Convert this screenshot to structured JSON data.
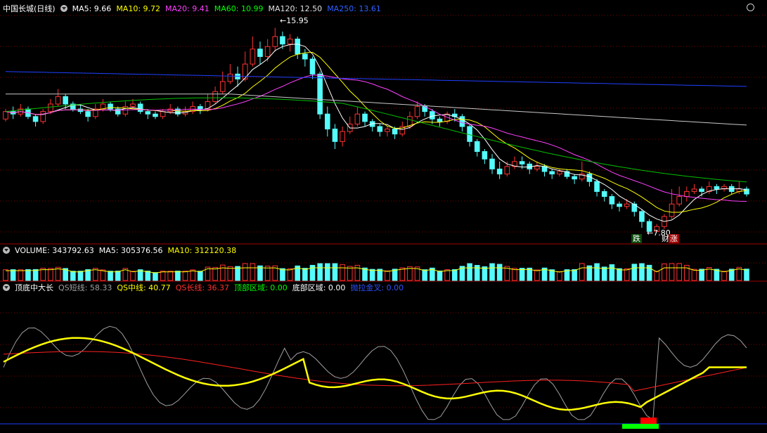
{
  "main_header": {
    "title": "中国长城(日线)",
    "ma_labels": [
      {
        "text": "MA5: 9.66",
        "color": "#ffffff"
      },
      {
        "text": "MA10: 9.72",
        "color": "#ffff00"
      },
      {
        "text": "MA20: 9.41",
        "color": "#ff40ff"
      },
      {
        "text": "MA60: 10.99",
        "color": "#00ff00"
      },
      {
        "text": "MA120: 12.50",
        "color": "#e0e0e0"
      },
      {
        "text": "MA250: 13.61",
        "color": "#3060ff"
      }
    ]
  },
  "volume_header": {
    "labels": [
      {
        "text": "VOLUME: 343792.63",
        "color": "#ffffff"
      },
      {
        "text": "MA5: 305376.56",
        "color": "#ffffff"
      },
      {
        "text": "MA10: 312120.38",
        "color": "#ffff00"
      }
    ]
  },
  "indicator_header": {
    "labels": [
      {
        "text": "顶底中大长",
        "color": "#ffffff"
      },
      {
        "text": "QS短线: 58.33",
        "color": "#a0a0a0"
      },
      {
        "text": "QS中线: 40.77",
        "color": "#ffff00"
      },
      {
        "text": "QS长线: 36.37",
        "color": "#ff3030"
      },
      {
        "text": "顶部区域: 0.00",
        "color": "#00ff00"
      },
      {
        "text": "底部区域: 0.00",
        "color": "#ffffff"
      },
      {
        "text": "抛拉金叉: 0.00",
        "color": "#3050ff"
      }
    ]
  },
  "markers": {
    "high": "15.95",
    "low": "7.80",
    "tag_fall": "跌",
    "tag_rise_1": "财",
    "tag_rise_2": "涨"
  },
  "colors": {
    "up": "#ff3232",
    "down": "#54fcfc",
    "grid": "#7a0000",
    "ma5": "#ffffff",
    "ma10": "#ffff00",
    "ma20": "#ff40ff",
    "ma60": "#00c000",
    "ma120": "#c8c8c8",
    "ma250": "#2040ff"
  },
  "chart_data": {
    "type": "candlestick",
    "price_axis": {
      "high": 15.95,
      "low": 7.8
    },
    "ma_latest": {
      "MA5": 9.66,
      "MA10": 9.72,
      "MA20": 9.41,
      "MA60": 10.99,
      "MA120": 12.5,
      "MA250": 13.61
    },
    "candles": [
      [
        12.3,
        12.6,
        12.7,
        12.2
      ],
      [
        12.6,
        12.5,
        12.8,
        12.3
      ],
      [
        12.5,
        12.7,
        12.9,
        12.4
      ],
      [
        12.7,
        12.4,
        12.8,
        12.3
      ],
      [
        12.4,
        12.2,
        12.5,
        12.0
      ],
      [
        12.2,
        12.6,
        12.7,
        12.1
      ],
      [
        12.6,
        12.9,
        13.1,
        12.5
      ],
      [
        12.9,
        13.2,
        13.5,
        12.8
      ],
      [
        13.2,
        12.9,
        13.3,
        12.7
      ],
      [
        12.9,
        12.7,
        13.0,
        12.6
      ],
      [
        12.7,
        12.6,
        12.9,
        12.5
      ],
      [
        12.6,
        12.4,
        12.7,
        12.2
      ],
      [
        12.4,
        12.7,
        12.9,
        12.3
      ],
      [
        12.7,
        12.9,
        13.1,
        12.6
      ],
      [
        12.9,
        12.7,
        13.0,
        12.6
      ],
      [
        12.7,
        12.5,
        12.8,
        12.4
      ],
      [
        12.5,
        12.8,
        13.0,
        12.4
      ],
      [
        12.8,
        12.9,
        13.1,
        12.7
      ],
      [
        12.9,
        12.6,
        13.0,
        12.5
      ],
      [
        12.6,
        12.5,
        12.7,
        12.3
      ],
      [
        12.5,
        12.4,
        12.6,
        12.3
      ],
      [
        12.4,
        12.6,
        12.7,
        12.3
      ],
      [
        12.6,
        12.7,
        12.9,
        12.5
      ],
      [
        12.7,
        12.5,
        12.8,
        12.4
      ],
      [
        12.5,
        12.6,
        12.8,
        12.4
      ],
      [
        12.6,
        12.8,
        13.0,
        12.5
      ],
      [
        12.8,
        12.7,
        12.9,
        12.5
      ],
      [
        12.7,
        13.0,
        13.3,
        12.6
      ],
      [
        13.0,
        13.4,
        13.6,
        12.9
      ],
      [
        13.4,
        13.8,
        14.2,
        13.3
      ],
      [
        13.8,
        14.1,
        14.5,
        13.7
      ],
      [
        14.1,
        13.9,
        14.4,
        13.6
      ],
      [
        13.9,
        14.5,
        15.0,
        13.8
      ],
      [
        14.5,
        15.1,
        15.6,
        14.4
      ],
      [
        15.1,
        14.8,
        15.4,
        14.5
      ],
      [
        14.8,
        15.2,
        15.5,
        14.6
      ],
      [
        15.2,
        15.6,
        15.95,
        15.0
      ],
      [
        15.6,
        15.3,
        15.8,
        15.1
      ],
      [
        15.3,
        15.5,
        15.7,
        15.0
      ],
      [
        15.5,
        14.9,
        15.6,
        14.7
      ],
      [
        14.9,
        14.7,
        15.1,
        14.4
      ],
      [
        14.7,
        14.1,
        14.8,
        13.9
      ],
      [
        14.1,
        12.5,
        14.2,
        12.3
      ],
      [
        12.5,
        11.9,
        12.8,
        11.6
      ],
      [
        11.9,
        11.4,
        12.1,
        11.1
      ],
      [
        11.4,
        11.8,
        12.0,
        11.2
      ],
      [
        11.8,
        12.1,
        12.4,
        11.7
      ],
      [
        12.1,
        12.5,
        12.8,
        12.0
      ],
      [
        12.5,
        12.2,
        12.6,
        12.0
      ],
      [
        12.2,
        12.0,
        12.3,
        11.8
      ],
      [
        12.0,
        11.8,
        12.1,
        11.6
      ],
      [
        11.8,
        11.9,
        12.0,
        11.6
      ],
      [
        11.9,
        11.7,
        12.0,
        11.5
      ],
      [
        11.7,
        12.0,
        12.2,
        11.6
      ],
      [
        12.0,
        12.4,
        12.6,
        11.9
      ],
      [
        12.4,
        12.8,
        13.0,
        12.3
      ],
      [
        12.8,
        12.6,
        12.9,
        12.4
      ],
      [
        12.6,
        12.3,
        12.7,
        12.1
      ],
      [
        12.3,
        12.2,
        12.4,
        12.0
      ],
      [
        12.2,
        12.5,
        12.6,
        12.1
      ],
      [
        12.5,
        12.4,
        12.7,
        12.2
      ],
      [
        12.4,
        12.0,
        12.5,
        11.8
      ],
      [
        12.0,
        11.4,
        12.1,
        11.2
      ],
      [
        11.4,
        11.0,
        11.5,
        10.8
      ],
      [
        11.0,
        10.7,
        11.1,
        10.5
      ],
      [
        10.7,
        10.3,
        10.9,
        10.1
      ],
      [
        10.3,
        10.1,
        10.6,
        9.9
      ],
      [
        10.1,
        10.4,
        10.6,
        10.0
      ],
      [
        10.4,
        10.6,
        10.8,
        10.3
      ],
      [
        10.6,
        10.5,
        10.8,
        10.3
      ],
      [
        10.5,
        10.3,
        10.6,
        10.1
      ],
      [
        10.3,
        10.4,
        10.6,
        10.2
      ],
      [
        10.4,
        10.2,
        10.5,
        10.0
      ],
      [
        10.2,
        10.1,
        10.3,
        9.9
      ],
      [
        10.1,
        10.2,
        10.3,
        10.0
      ],
      [
        10.2,
        10.0,
        10.3,
        9.9
      ],
      [
        10.0,
        9.9,
        10.1,
        9.7
      ],
      [
        9.9,
        10.1,
        10.6,
        9.8
      ],
      [
        10.1,
        9.8,
        10.2,
        9.6
      ],
      [
        9.8,
        9.4,
        9.9,
        9.2
      ],
      [
        9.4,
        9.2,
        9.5,
        9.0
      ],
      [
        9.2,
        8.9,
        9.3,
        8.7
      ],
      [
        8.9,
        8.8,
        9.0,
        8.6
      ],
      [
        8.8,
        8.9,
        9.1,
        8.7
      ],
      [
        8.9,
        8.6,
        9.0,
        8.4
      ],
      [
        8.6,
        8.2,
        8.7,
        7.95
      ],
      [
        8.2,
        7.8,
        8.3,
        7.8
      ],
      [
        7.8,
        8.0,
        8.1,
        7.85
      ],
      [
        8.0,
        8.4,
        8.5,
        7.9
      ],
      [
        8.4,
        8.9,
        9.5,
        8.3
      ],
      [
        8.9,
        9.2,
        9.6,
        8.8
      ],
      [
        9.2,
        9.4,
        9.6,
        9.0
      ],
      [
        9.4,
        9.5,
        9.7,
        9.3
      ],
      [
        9.5,
        9.4,
        9.6,
        9.2
      ],
      [
        9.4,
        9.6,
        9.8,
        9.3
      ],
      [
        9.6,
        9.5,
        9.7,
        9.3
      ],
      [
        9.5,
        9.6,
        9.7,
        9.4
      ],
      [
        9.6,
        9.4,
        9.7,
        9.3
      ],
      [
        9.4,
        9.5,
        9.8,
        9.3
      ],
      [
        9.5,
        9.3,
        9.6,
        9.2
      ]
    ]
  }
}
